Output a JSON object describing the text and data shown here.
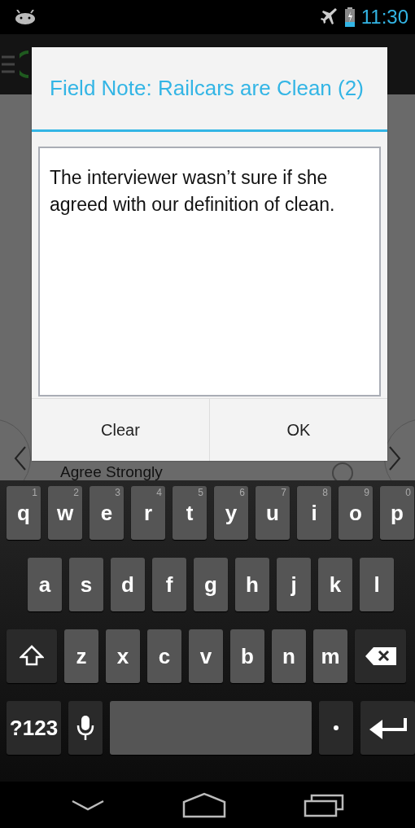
{
  "status_bar": {
    "time": "11:30"
  },
  "background_app": {
    "option_label": "Agree Strongly",
    "option_checked": false
  },
  "dialog": {
    "title": "Field Note: Railcars are Clean (2)",
    "note": "The interviewer wasn’t sure if she agreed with our definition of clean.",
    "buttons": [
      "Clear",
      "OK"
    ]
  },
  "keyboard": {
    "rows": [
      [
        {
          "kind": "letter",
          "label": "q",
          "hint": "1"
        },
        {
          "kind": "letter",
          "label": "w",
          "hint": "2"
        },
        {
          "kind": "letter",
          "label": "e",
          "hint": "3"
        },
        {
          "kind": "letter",
          "label": "r",
          "hint": "4"
        },
        {
          "kind": "letter",
          "label": "t",
          "hint": "5"
        },
        {
          "kind": "letter",
          "label": "y",
          "hint": "6"
        },
        {
          "kind": "letter",
          "label": "u",
          "hint": "7"
        },
        {
          "kind": "letter",
          "label": "i",
          "hint": "8"
        },
        {
          "kind": "letter",
          "label": "o",
          "hint": "9"
        },
        {
          "kind": "letter",
          "label": "p",
          "hint": "0"
        }
      ],
      [
        {
          "kind": "letter",
          "label": "a"
        },
        {
          "kind": "letter",
          "label": "s"
        },
        {
          "kind": "letter",
          "label": "d"
        },
        {
          "kind": "letter",
          "label": "f"
        },
        {
          "kind": "letter",
          "label": "g"
        },
        {
          "kind": "letter",
          "label": "h"
        },
        {
          "kind": "letter",
          "label": "j"
        },
        {
          "kind": "letter",
          "label": "k"
        },
        {
          "kind": "letter",
          "label": "l"
        }
      ],
      [
        {
          "kind": "shift"
        },
        {
          "kind": "letter",
          "label": "z"
        },
        {
          "kind": "letter",
          "label": "x"
        },
        {
          "kind": "letter",
          "label": "c"
        },
        {
          "kind": "letter",
          "label": "v"
        },
        {
          "kind": "letter",
          "label": "b"
        },
        {
          "kind": "letter",
          "label": "n"
        },
        {
          "kind": "letter",
          "label": "m"
        },
        {
          "kind": "backspace"
        }
      ],
      [
        {
          "kind": "symbols",
          "label": "?123"
        },
        {
          "kind": "mic"
        },
        {
          "kind": "space"
        },
        {
          "kind": "period"
        },
        {
          "kind": "enter"
        }
      ]
    ]
  }
}
